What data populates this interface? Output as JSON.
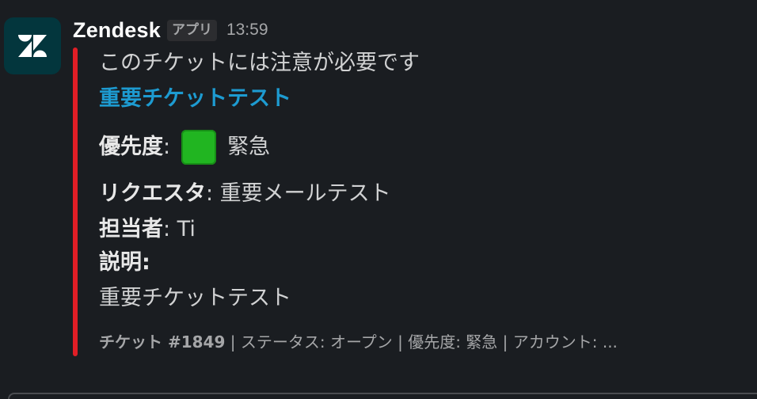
{
  "message": {
    "sender": "Zendesk",
    "app_badge": "アプリ",
    "timestamp": "13:59",
    "pretext": "このチケットには注意が必要です",
    "ticket_title": "重要チケットテスト",
    "accent_color": "#e01e26",
    "link_color": "#1d9bd1"
  },
  "fields": {
    "priority_label": "優先度",
    "priority_colon": ":",
    "priority_icon": "green-square-icon",
    "priority_value": "緊急",
    "requester_label": "リクエスタ",
    "requester_value": ": 重要メールテスト",
    "assignee_label": "担当者",
    "assignee_value": ": Ti",
    "description_label": "説明:",
    "description_value": "重要チケットテスト"
  },
  "footer": {
    "ticket_number": "チケット #1849",
    "details": " | ステータス: オープン | 優先度: 緊急 | アカウント: ..."
  }
}
